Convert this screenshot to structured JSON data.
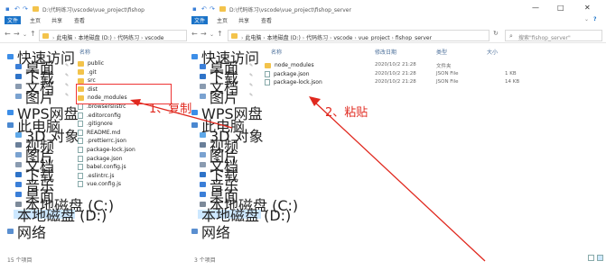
{
  "left": {
    "title_path": "D:\\代码练习\\vscode\\vue_project\\fishop",
    "ribbon": [
      "文件",
      "主页",
      "共享",
      "查看"
    ],
    "breadcrumb": [
      "此电脑",
      "本地磁盘 (D:)",
      "代码练习",
      "vscode"
    ],
    "column_name": "名称",
    "nav": [
      {
        "label": "快速访问",
        "icon": "star-icon",
        "color": "#3c8ee8"
      },
      {
        "label": "桌面",
        "icon": "desktop-icon",
        "color": "#3b7fd8"
      },
      {
        "label": "下载",
        "icon": "download-icon",
        "color": "#2e73c8"
      },
      {
        "label": "文档",
        "icon": "document-icon",
        "color": "#8a9bb0"
      },
      {
        "label": "图片",
        "icon": "picture-icon",
        "color": "#7aa2d0"
      },
      {
        "label": "WPS网盘",
        "icon": "cloud-icon",
        "color": "#3c8ee8"
      },
      {
        "label": "此电脑",
        "icon": "computer-icon",
        "color": "#4a88d0"
      },
      {
        "label": "3D 对象",
        "icon": "cube-icon",
        "color": "#5fa8e8"
      },
      {
        "label": "视频",
        "icon": "video-icon",
        "color": "#6a7f99"
      },
      {
        "label": "图片",
        "icon": "picture-icon",
        "color": "#7aa2d0"
      },
      {
        "label": "文档",
        "icon": "document-icon",
        "color": "#8a9bb0"
      },
      {
        "label": "下载",
        "icon": "download-icon",
        "color": "#2e73c8"
      },
      {
        "label": "音乐",
        "icon": "music-icon",
        "color": "#3b7fd8"
      },
      {
        "label": "桌面",
        "icon": "desktop-icon",
        "color": "#3b7fd8"
      },
      {
        "label": "本地磁盘 (C:)",
        "icon": "drive-icon",
        "color": "#7d8a99"
      },
      {
        "label": "本地磁盘 (D:)",
        "icon": "drive-icon",
        "color": "#7d8a99"
      },
      {
        "label": "网络",
        "icon": "network-icon",
        "color": "#5a8fd0"
      }
    ],
    "files": [
      {
        "name": "public",
        "kind": "folder"
      },
      {
        "name": ".git",
        "kind": "folder"
      },
      {
        "name": "src",
        "kind": "folder"
      },
      {
        "name": "dist",
        "kind": "folder"
      },
      {
        "name": "node_modules",
        "kind": "folder"
      },
      {
        "name": ".browserslistrc",
        "kind": "file"
      },
      {
        "name": ".editorconfig",
        "kind": "file"
      },
      {
        "name": ".gitignore",
        "kind": "file"
      },
      {
        "name": "README.md",
        "kind": "file"
      },
      {
        "name": ".prettierrc.json",
        "kind": "file"
      },
      {
        "name": "package-lock.json",
        "kind": "file"
      },
      {
        "name": "package.json",
        "kind": "file"
      },
      {
        "name": "babel.config.js",
        "kind": "file"
      },
      {
        "name": ".eslintrc.js",
        "kind": "file"
      },
      {
        "name": "vue.config.js",
        "kind": "file"
      }
    ],
    "status": "15 个项目"
  },
  "right": {
    "title_path": "D:\\代码练习\\vscode\\vue_project\\fishop_server",
    "ribbon": [
      "文件",
      "主页",
      "共享",
      "查看"
    ],
    "breadcrumb": [
      "此电脑",
      "本地磁盘 (D:)",
      "代码练习",
      "vscode",
      "vue_project",
      "fishop_server"
    ],
    "search_placeholder": "搜索\"fishop_server\"",
    "columns": [
      "名称",
      "修改日期",
      "类型",
      "大小"
    ],
    "nav": [
      {
        "label": "快速访问",
        "icon": "star-icon",
        "color": "#3c8ee8"
      },
      {
        "label": "桌面",
        "icon": "desktop-icon",
        "color": "#3b7fd8"
      },
      {
        "label": "下载",
        "icon": "download-icon",
        "color": "#2e73c8"
      },
      {
        "label": "文档",
        "icon": "document-icon",
        "color": "#8a9bb0"
      },
      {
        "label": "图片",
        "icon": "picture-icon",
        "color": "#7aa2d0"
      },
      {
        "label": "WPS网盘",
        "icon": "cloud-icon",
        "color": "#3c8ee8"
      },
      {
        "label": "此电脑",
        "icon": "computer-icon",
        "color": "#4a88d0"
      },
      {
        "label": "3D 对象",
        "icon": "cube-icon",
        "color": "#5fa8e8"
      },
      {
        "label": "视频",
        "icon": "video-icon",
        "color": "#6a7f99"
      },
      {
        "label": "图片",
        "icon": "picture-icon",
        "color": "#7aa2d0"
      },
      {
        "label": "文档",
        "icon": "document-icon",
        "color": "#8a9bb0"
      },
      {
        "label": "下载",
        "icon": "download-icon",
        "color": "#2e73c8"
      },
      {
        "label": "音乐",
        "icon": "music-icon",
        "color": "#3b7fd8"
      },
      {
        "label": "桌面",
        "icon": "desktop-icon",
        "color": "#3b7fd8"
      },
      {
        "label": "本地磁盘 (C:)",
        "icon": "drive-icon",
        "color": "#7d8a99"
      },
      {
        "label": "本地磁盘 (D:)",
        "icon": "drive-icon",
        "color": "#7d8a99"
      },
      {
        "label": "网络",
        "icon": "network-icon",
        "color": "#5a8fd0"
      }
    ],
    "files": [
      {
        "name": "node_modules",
        "kind": "folder",
        "date": "2020/10/2 21:28",
        "type": "文件夹",
        "size": ""
      },
      {
        "name": "package.json",
        "kind": "file",
        "date": "2020/10/2 21:28",
        "type": "JSON File",
        "size": "1 KB"
      },
      {
        "name": "package-lock.json",
        "kind": "file",
        "date": "2020/10/2 21:28",
        "type": "JSON File",
        "size": "14 KB"
      }
    ],
    "status": "3 个项目"
  },
  "annotations": {
    "copy": "1、复制",
    "paste": "2、粘贴",
    "color": "#e0281e"
  }
}
